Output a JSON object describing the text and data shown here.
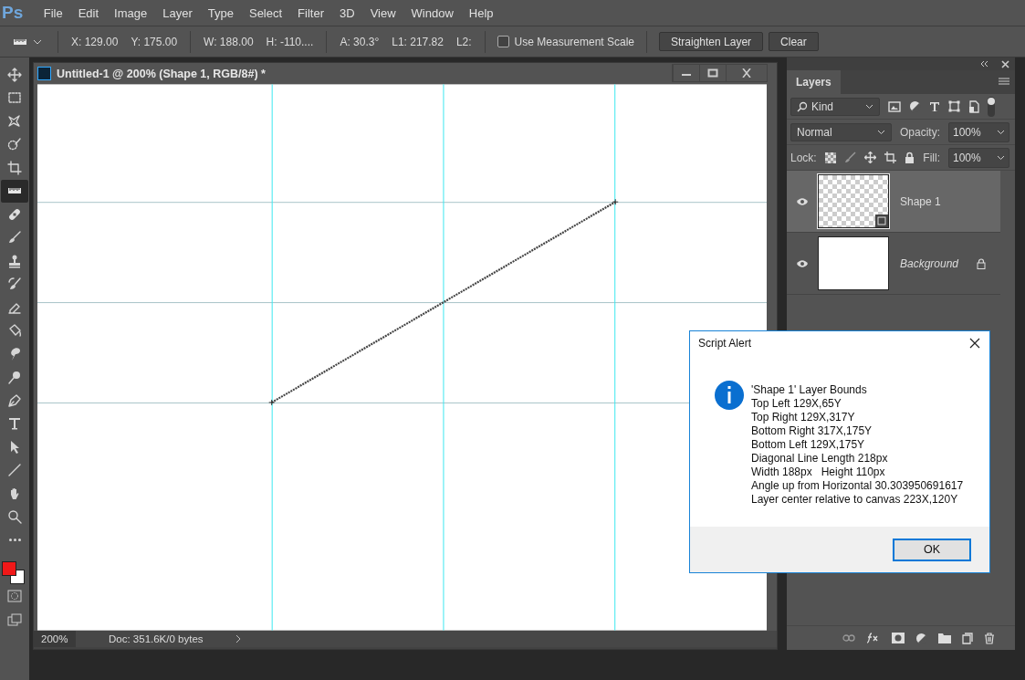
{
  "app": {
    "logo": "Ps"
  },
  "menu": [
    "File",
    "Edit",
    "Image",
    "Layer",
    "Type",
    "Select",
    "Filter",
    "3D",
    "View",
    "Window",
    "Help"
  ],
  "options_bar": {
    "readouts": [
      {
        "label": "X:",
        "value": "129.00"
      },
      {
        "label": "Y:",
        "value": "175.00"
      },
      {
        "label": "W:",
        "value": "188.00"
      },
      {
        "label": "H:",
        "value": "-110...."
      },
      {
        "label": "A:",
        "value": "30.3°"
      },
      {
        "label": "L1:",
        "value": "217.82"
      },
      {
        "label": "L2:"
      }
    ],
    "checkbox": {
      "label": "Use Measurement Scale",
      "checked": false
    },
    "buttons": [
      "Straighten Layer",
      "Clear"
    ]
  },
  "tools": [
    {
      "kind": "move",
      "selected": false
    },
    {
      "kind": "marquee",
      "selected": false
    },
    {
      "kind": "lasso",
      "selected": false
    },
    {
      "kind": "quickselect",
      "selected": false
    },
    {
      "kind": "crop",
      "selected": false
    },
    {
      "kind": "ruler",
      "selected": true
    },
    {
      "kind": "bandage",
      "selected": false
    },
    {
      "kind": "brush",
      "selected": false
    },
    {
      "kind": "stamp",
      "selected": false
    },
    {
      "kind": "historybrush",
      "selected": false
    },
    {
      "kind": "eraser",
      "selected": false
    },
    {
      "kind": "bucket",
      "selected": false
    },
    {
      "kind": "smudge",
      "selected": false
    },
    {
      "kind": "dodge",
      "selected": false
    },
    {
      "kind": "pen",
      "selected": false
    },
    {
      "kind": "type",
      "selected": false
    },
    {
      "kind": "pointer",
      "selected": false
    },
    {
      "kind": "line",
      "selected": false
    },
    {
      "kind": "hand",
      "selected": false
    },
    {
      "kind": "zoom",
      "selected": false
    },
    {
      "kind": "more",
      "selected": false
    }
  ],
  "document": {
    "title": "Untitled-1 @ 200% (Shape 1, RGB/8#) *",
    "zoom": "200%",
    "info": "Doc: 351.6K/0 bytes"
  },
  "layers_panel": {
    "tab": "Layers",
    "filter": "Kind",
    "blend_mode": "Normal",
    "opacity_label": "Opacity:",
    "opacity": "100%",
    "lock_label": "Lock:",
    "fill_label": "Fill:",
    "fill": "100%",
    "layers": [
      {
        "name": "Shape 1",
        "kind": "shape",
        "selected": true,
        "visible": true,
        "locked": false
      },
      {
        "name": "Background",
        "kind": "background",
        "selected": false,
        "visible": true,
        "locked": true
      }
    ]
  },
  "dialog": {
    "title": "Script Alert",
    "lines": [
      "'Shape 1' Layer Bounds",
      "Top Left 129X,65Y",
      "Top Right 129X,317Y",
      "Bottom Right 317X,175Y",
      "Bottom Left 129X,175Y",
      "Diagonal Line Length 218px",
      "Width 188px   Height 110px",
      "Angle up from Horizontal 30.303950691617",
      "Layer center relative to canvas 223X,120Y"
    ],
    "button": "OK"
  }
}
